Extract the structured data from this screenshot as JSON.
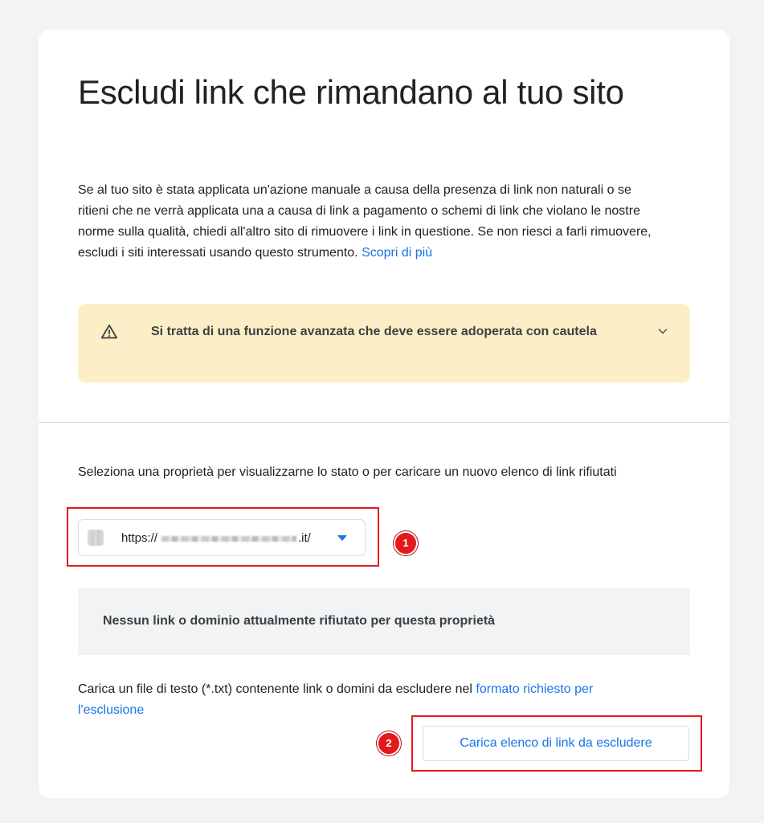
{
  "page": {
    "title": "Escludi link che rimandano al tuo sito",
    "description": "Se al tuo sito è stata applicata un'azione manuale a causa della presenza di link non naturali o se ritieni che ne verrà applicata una a causa di link a pagamento o schemi di link che violano le nostre norme sulla qualità, chiedi all'altro sito di rimuovere i link in questione. Se non riesci a farli rimuovere, escludi i siti interessati usando questo strumento.",
    "learn_more_link": "Scopri di più"
  },
  "warning": {
    "icon": "warning-triangle-icon",
    "text": "Si tratta di una funzione avanzata che deve essere adoperata con cautela",
    "expand_icon": "chevron-down-icon"
  },
  "property": {
    "label": "Seleziona una proprietà per visualizzarne lo stato o per caricare un nuovo elenco di link rifiutati",
    "selected_prefix": "https://",
    "selected_suffix": ".it/",
    "dropdown_icon": "caret-down-icon"
  },
  "status": {
    "text": "Nessun link o dominio attualmente rifiutato per questa proprietà"
  },
  "upload": {
    "description": "Carica un file di testo (*.txt) contenente link o domini da escludere nel",
    "format_link": "formato richiesto per l'esclusione",
    "button_label": "Carica elenco di link da escludere"
  },
  "annotations": {
    "marker_1": "1",
    "marker_2": "2",
    "callout_color": "#e3191c"
  },
  "colors": {
    "accent": "#1a73e8",
    "warning_bg": "#fcefc7",
    "status_bg": "#f1f3f4",
    "page_bg": "#f1f3f4"
  }
}
